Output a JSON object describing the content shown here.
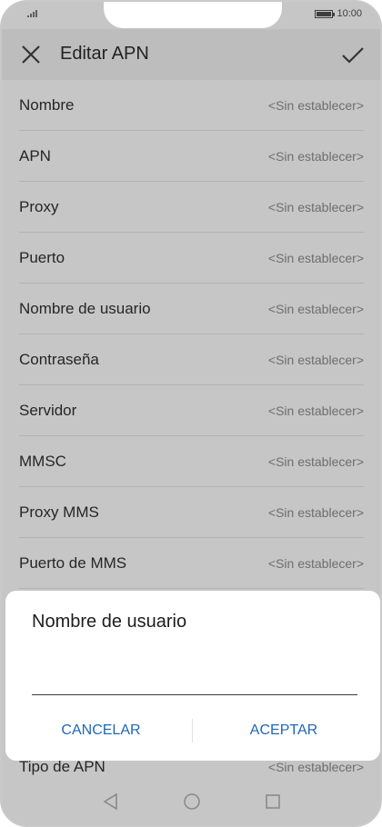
{
  "status_bar": {
    "time": "10:00"
  },
  "toolbar": {
    "title": "Editar APN"
  },
  "list": {
    "items": [
      {
        "label": "Nombre",
        "value": "<Sin establecer>"
      },
      {
        "label": "APN",
        "value": "<Sin establecer>"
      },
      {
        "label": "Proxy",
        "value": "<Sin establecer>"
      },
      {
        "label": "Puerto",
        "value": "<Sin establecer>"
      },
      {
        "label": "Nombre de usuario",
        "value": "<Sin establecer>"
      },
      {
        "label": "Contraseña",
        "value": "<Sin establecer>"
      },
      {
        "label": "Servidor",
        "value": "<Sin establecer>"
      },
      {
        "label": "MMSC",
        "value": "<Sin establecer>"
      },
      {
        "label": "Proxy MMS",
        "value": "<Sin establecer>"
      },
      {
        "label": "Puerto de MMS",
        "value": "<Sin establecer>"
      },
      {
        "label": "Tipo de APN",
        "value": "<Sin establecer>"
      }
    ]
  },
  "dialog": {
    "title": "Nombre de usuario",
    "input_value": "",
    "cancel_label": "CANCELAR",
    "accept_label": "ACEPTAR"
  },
  "colors": {
    "accent": "#2067b8",
    "overlay": "#c6c6c6"
  },
  "icons": {
    "close": "close-icon",
    "confirm": "check-icon",
    "back": "back-triangle-icon",
    "home": "home-circle-icon",
    "recents": "recents-square-icon"
  }
}
